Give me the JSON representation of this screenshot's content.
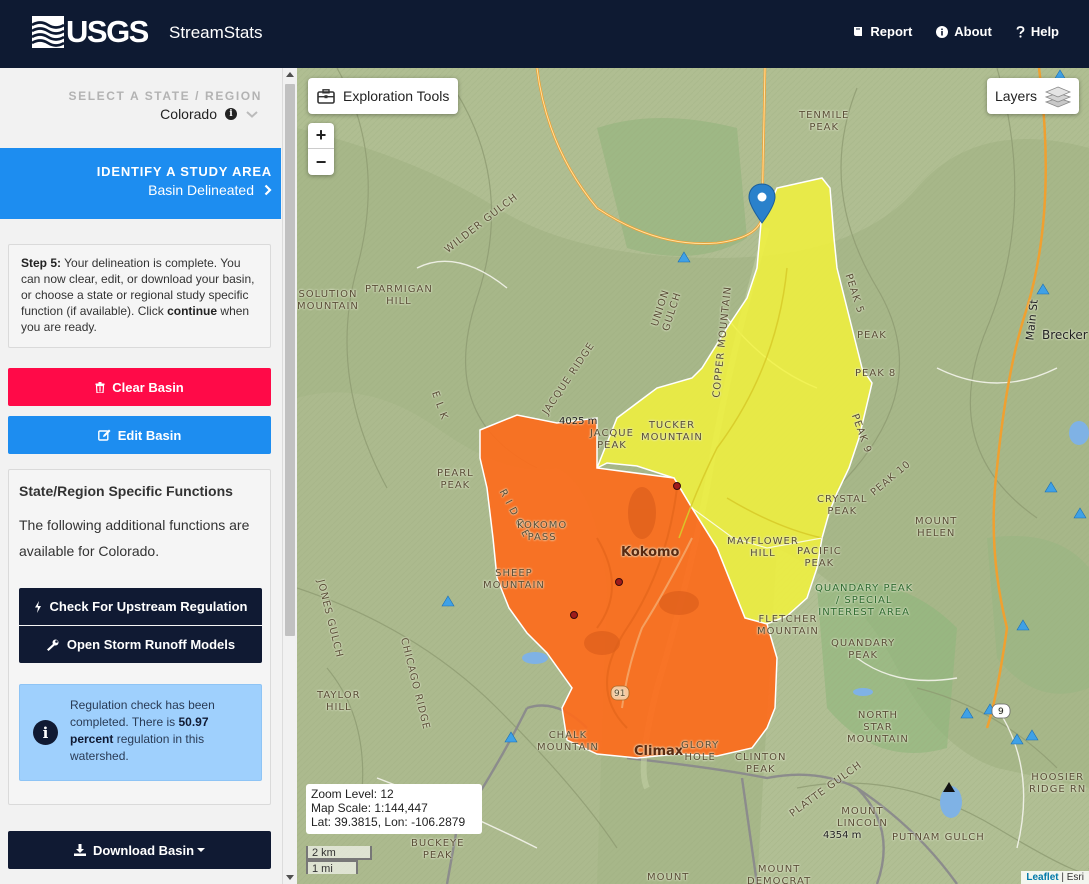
{
  "header": {
    "logo_text": "USGS",
    "app_name": "StreamStats",
    "nav": [
      {
        "label": "Report",
        "icon": "book-icon"
      },
      {
        "label": "About",
        "icon": "info-icon"
      },
      {
        "label": "Help",
        "icon": "question-icon"
      }
    ]
  },
  "sidebar": {
    "state_label": "SELECT A STATE / REGION",
    "state_value": "Colorado",
    "study_title": "IDENTIFY A STUDY AREA",
    "study_sub": "Basin Delineated",
    "step_label": "Step 5:",
    "step_text_1": " Your delineation is complete. You can now clear, edit, or download your basin, or choose a state or regional study specific function (if available). Click ",
    "step_bold": "continue",
    "step_text_2": " when you are ready.",
    "clear_label": "Clear Basin",
    "edit_label": "Edit Basin",
    "functions_title": "State/Region Specific Functions",
    "functions_desc": "The following additional functions are available for Colorado.",
    "upstream_label": "Check For Upstream Regulation",
    "storm_label": "Open Storm Runoff Models",
    "alert_text_1": "Regulation check has been completed. There is ",
    "alert_bold": "50.97 percent",
    "alert_text_2": " regulation in this watershed.",
    "download_label": "Download Basin"
  },
  "map": {
    "exploration_label": "Exploration Tools",
    "layers_label": "Layers",
    "zoom_in": "+",
    "zoom_out": "−",
    "zoom_level": "Zoom Level: 12",
    "map_scale": "Map Scale: 1:144,447",
    "lat_lon": "Lat: 39.3815, Lon: -106.2879",
    "scale_km": "2 km",
    "scale_mi": "1 mi",
    "attribution_leaflet": "Leaflet",
    "attribution_esri": "Esri",
    "colors": {
      "basin_yellow": "#f2f23c",
      "basin_orange": "#ff6a1a",
      "marker": "#2a81cb"
    },
    "labels": {
      "tenmile_peak": "TENMILE\nPEAK",
      "wilder_gulch": "WILDER GULCH",
      "ptarmigan_hill": "PTARMIGAN\nHILL",
      "solution_mountain": "SOLUTION\nMOUNTAIN",
      "union_gulch": "UNION\nGULCH",
      "copper_mountain": "COPPER MOUNTAIN",
      "peak_5": "PEAK 5",
      "peak_7": "PEAK",
      "peak_8": "PEAK 8",
      "peak_9": "PEAK 9",
      "peak_10": "PEAK 10",
      "breckenridge": "Brecker",
      "main_st": "Main St",
      "tucker_mountain": "TUCKER\nMOUNTAIN",
      "jacque_peak": "JACQUE\nPEAK",
      "elev_4025": "4025 m",
      "ridge_1": "E L K",
      "ridge_2": "R I D G E",
      "ridge_3": "JACQUE RIDGE",
      "pearl_peak": "PEARL\nPEAK",
      "kokomo_pass": "KOKOMO\nPASS",
      "kokomo": "Kokomo",
      "crystal_peak": "CRYSTAL\nPEAK",
      "mount_helen": "MOUNT\nHELEN",
      "mayflower_hill": "MAYFLOWER\nHILL",
      "pacific_peak": "PACIFIC\nPEAK",
      "sheep_mountain": "SHEEP\nMOUNTAIN",
      "quandary_special": "QUANDARY PEAK\n/ SPECIAL\nINTEREST AREA",
      "quandary_peak": "QUANDARY\nPEAK",
      "fletcher_mountain": "FLETCHER\nMOUNTAIN",
      "jones_gulch": "JONES GULCH",
      "chicago_ridge": "CHICAGO RIDGE",
      "taylor_hill": "TAYLOR\nHILL",
      "route_91": "91",
      "route_9": "9",
      "north_star": "NORTH\nSTAR\nMOUNTAIN",
      "chalk_mountain": "CHALK\nMOUNTAIN",
      "climax": "Climax",
      "glory_hole": "GLORY\nHOLE",
      "clinton_peak": "CLINTON\nPEAK",
      "platte_gulch": "PLATTE GULCH",
      "hoosier_ridge": "HOOSIER\nRIDGE RN",
      "mount_lincoln": "MOUNT\nLINCOLN",
      "elev_4354": "4354 m",
      "putnam_gulch": "PUTNAM GULCH",
      "buckeye_peak": "BUCKEYE\nPEAK",
      "mount_democrat": "MOUNT\nDEMOCRAT",
      "mount_bottom": "MOUNT"
    }
  }
}
